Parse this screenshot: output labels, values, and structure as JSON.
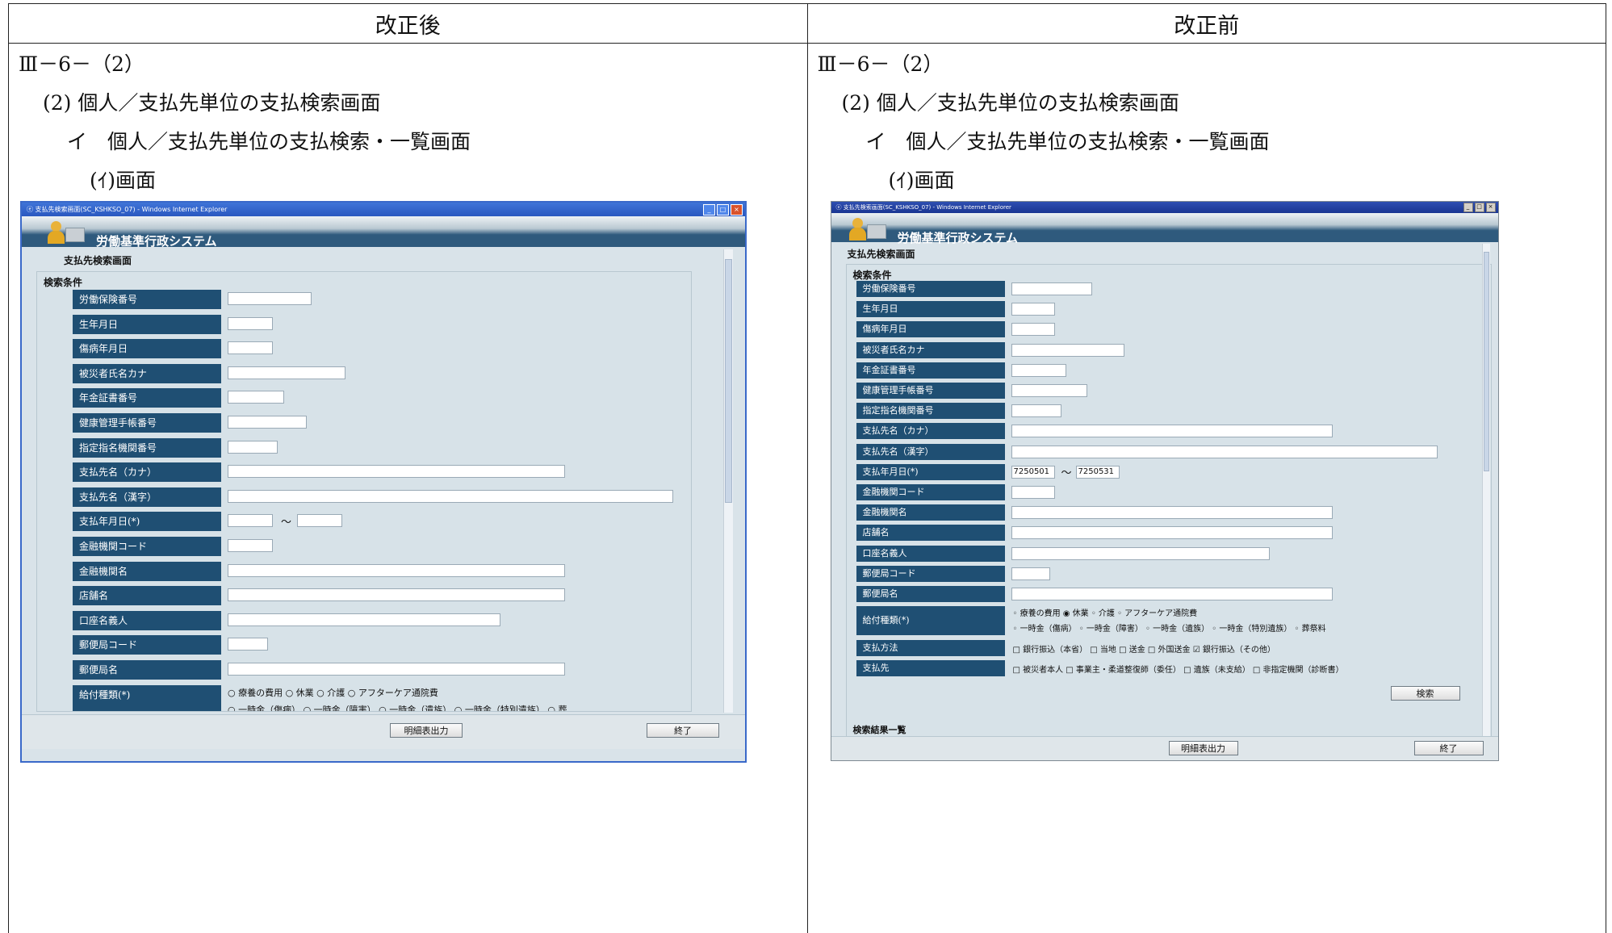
{
  "table": {
    "col_after": "改正後",
    "col_before": "改正前"
  },
  "after": {
    "section": "Ⅲ－6－（2）",
    "heading": "(2) 個人／支払先単位の支払検索画面",
    "sub": "イ　個人／支払先単位の支払検索・一覧画面",
    "subsub": "(ｲ)画面",
    "window": {
      "title": "支払先検索画面(SC_KSHKSO_07) - Windows Internet Explorer",
      "system_name": "労働基準行政システム",
      "screen_title": "支払先検索画面",
      "panel_title": "検索条件",
      "fields": [
        "労働保険番号",
        "生年月日",
        "傷病年月日",
        "被災者氏名カナ",
        "年金証書番号",
        "健康管理手帳番号",
        "指定指名機関番号",
        "支払先名（カナ）",
        "支払先名（漢字）",
        "支払年月日(*)",
        "金融機関コード",
        "金融機関名",
        "店舗名",
        "口座名義人",
        "郵便局コード",
        "郵便局名",
        "給付種類(*)"
      ],
      "date_from": "",
      "date_to": "",
      "options_row1": "○ 療養の費用 ○ 休業 ○ 介護 ○ アフターケア通院費",
      "options_row2": "○ 一時金（傷病） ○ 一時金（障害） ○ 一時金（遺族） ○ 一時金（特別遺族） ○ 葬",
      "btn_print": "明細表出力",
      "btn_end": "終了"
    }
  },
  "before": {
    "section": "Ⅲ－6－（2）",
    "heading": "(2) 個人／支払先単位の支払検索画面",
    "sub": "イ　個人／支払先単位の支払検索・一覧画面",
    "subsub": "(ｲ)画面",
    "window": {
      "title": "支払先検索画面(SC_KSHKSO_07) - Windows Internet Explorer",
      "system_name": "労働基準行政システム",
      "screen_title": "支払先検索画面",
      "panel_title": "検索条件",
      "fields": [
        "労働保険番号",
        "生年月日",
        "傷病年月日",
        "被災者氏名カナ",
        "年金証書番号",
        "健康管理手帳番号",
        "指定指名機関番号",
        "支払先名（カナ）",
        "支払先名（漢字）",
        "支払年月日(*)",
        "金融機関コード",
        "金融機関名",
        "店舗名",
        "口座名義人",
        "郵便局コード",
        "郵便局名",
        "給付種類(*)",
        "支払方法",
        "支払先"
      ],
      "date_from": "7250501",
      "date_to": "7250531",
      "kyufu_row1": "◦ 療養の費用 ◉ 休業 ◦ 介護 ◦ アフターケア通院費",
      "kyufu_row2": "◦ 一時金（傷病） ◦ 一時金（障害） ◦ 一時金（遺族） ◦ 一時金（特別遺族） ◦ 葬祭料",
      "shiharai_houhou": "□ 銀行振込（本省） □ 当地 □ 送金 □ 外国送金 ☑ 銀行振込（その他）",
      "shiharaisaki": "□ 被災者本人 □ 事業主・柔道整復師（委任） □ 遺族（未支給） □ 非指定機関（診断書）",
      "btn_search": "検索",
      "result_title": "検索結果一覧",
      "btn_print": "明細表出力",
      "btn_end": "終了"
    }
  }
}
